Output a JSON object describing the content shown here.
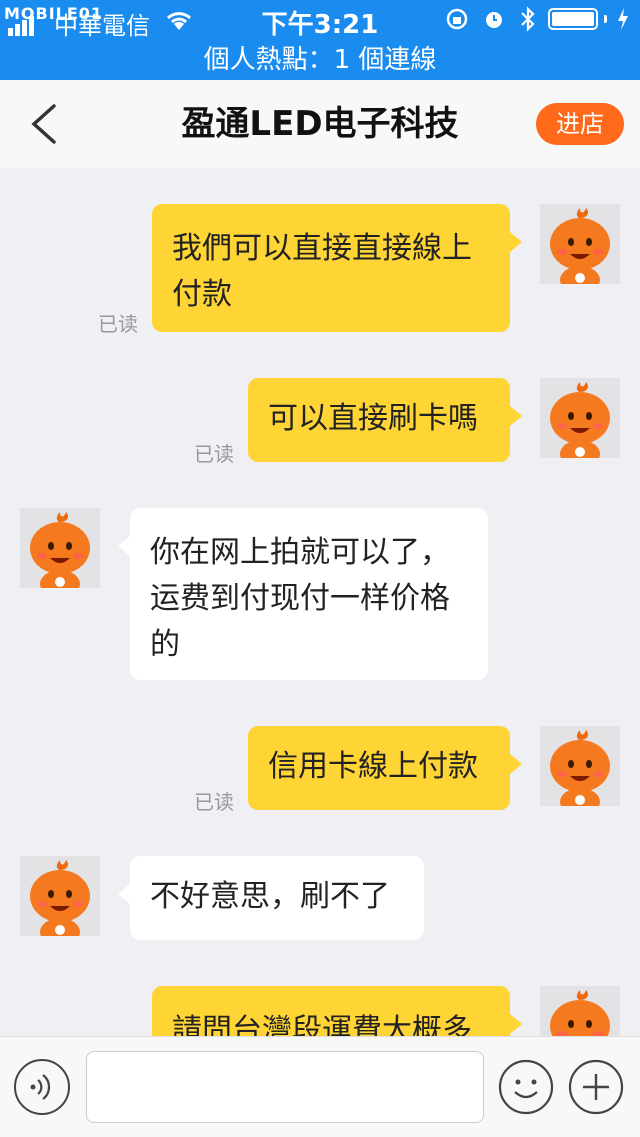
{
  "status_bar": {
    "watermark": "MOBILE01",
    "carrier": "中華電信",
    "time": "下午3:21"
  },
  "hotspot": {
    "text": "個人熱點：1 個連線"
  },
  "nav": {
    "title": "盈通LED电子科技",
    "enter_store": "进店"
  },
  "messages": [
    {
      "side": "me",
      "text": "我們可以直接直接線上付款",
      "status": "已读"
    },
    {
      "side": "me",
      "text": "可以直接刷卡嗎",
      "status": "已读"
    },
    {
      "side": "them",
      "text": "你在网上拍就可以了，运费到付现付一样价格的"
    },
    {
      "side": "me",
      "text": "信用卡線上付款",
      "status": "已读"
    },
    {
      "side": "them",
      "text": "不好意思，刷不了"
    },
    {
      "side": "me",
      "text": "請問台灣段運費大概多"
    }
  ],
  "input": {
    "value": "",
    "placeholder": ""
  },
  "colors": {
    "status_bar": "#1a8cf0",
    "accent": "#ff6a1a",
    "my_bubble": "#ffd535",
    "their_bubble": "#ffffff"
  },
  "icons": [
    "back-arrow-icon",
    "wifi-icon",
    "voice-icon",
    "emoji-icon",
    "plus-icon",
    "avatar-icon"
  ]
}
